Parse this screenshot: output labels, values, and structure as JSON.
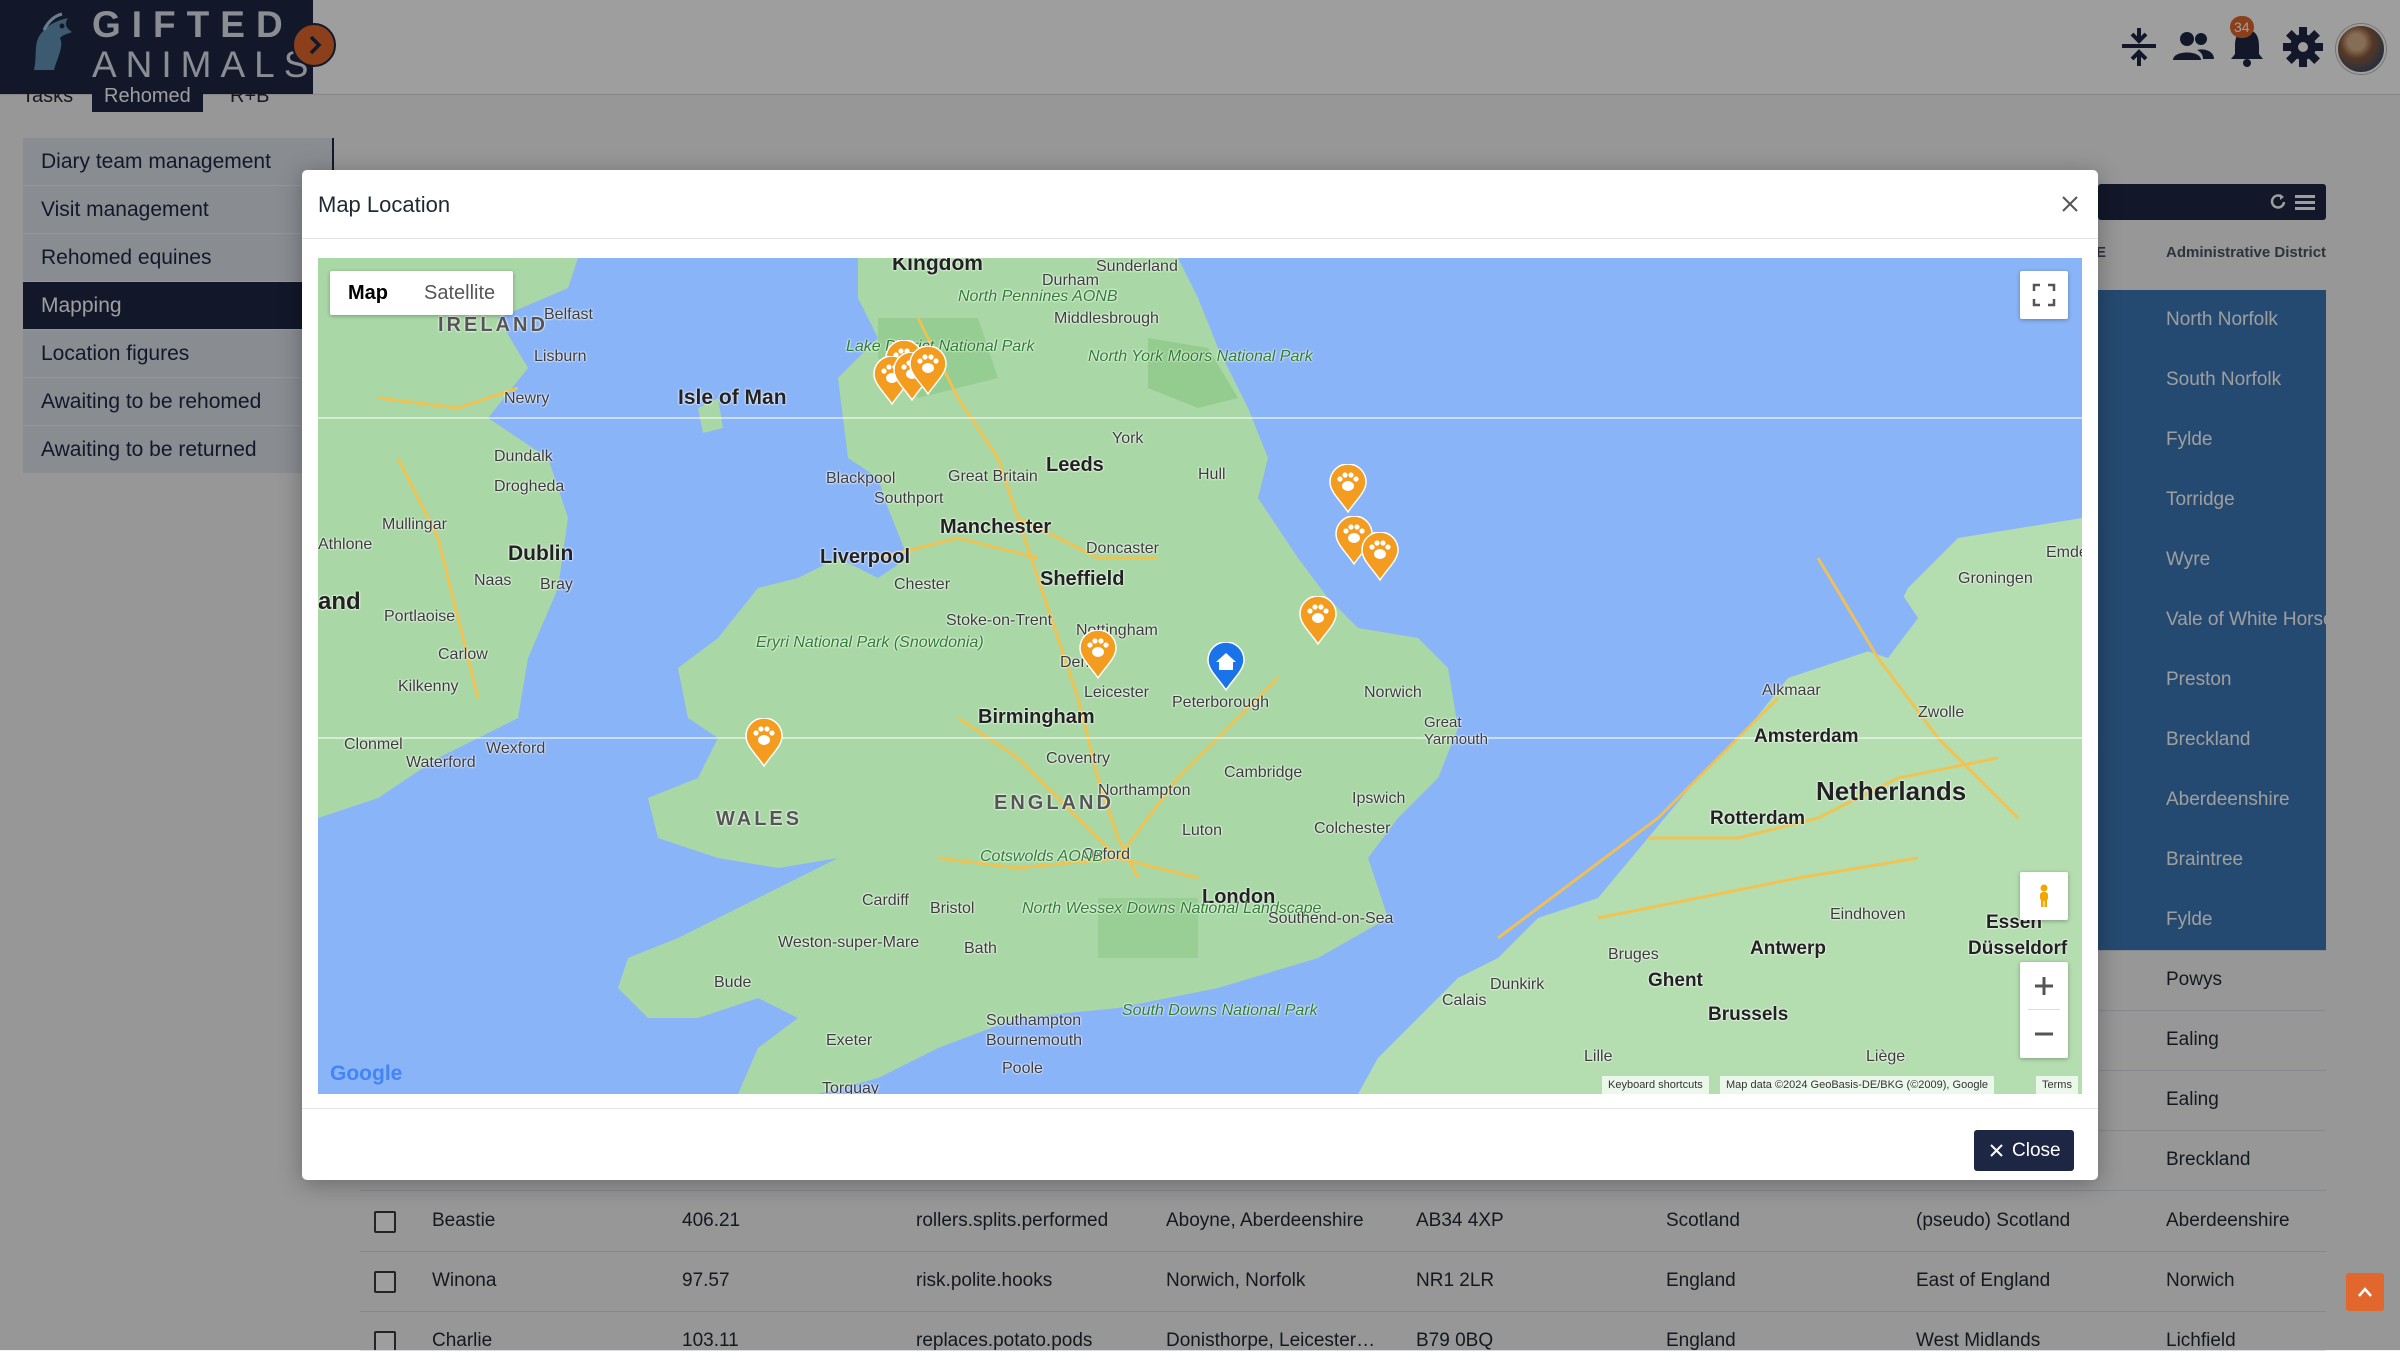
{
  "brand": {
    "line1": "GIFTED",
    "line2": "ANIMALS"
  },
  "header": {
    "notification_count": "34"
  },
  "tabs": [
    {
      "label": "Tasks"
    },
    {
      "label": "Rehomed"
    },
    {
      "label": "R+B"
    }
  ],
  "sidebar": {
    "items": [
      {
        "label": "Diary team management"
      },
      {
        "label": "Visit management"
      },
      {
        "label": "Rehomed equines"
      },
      {
        "label": "Mapping"
      },
      {
        "label": "Location figures"
      },
      {
        "label": "Awaiting to be rehomed"
      },
      {
        "label": "Awaiting to be returned"
      }
    ],
    "active_index": 3
  },
  "table": {
    "headers": {
      "col_e": "E",
      "admin_district": "Administrative District"
    },
    "partial_rows": [
      {
        "district": "North Norfolk",
        "selected": true
      },
      {
        "district": "South Norfolk",
        "selected": true
      },
      {
        "district": "Fylde",
        "selected": true
      },
      {
        "district": "Torridge",
        "selected": true
      },
      {
        "district": "Wyre",
        "selected": true
      },
      {
        "district": "Vale of White Horse",
        "selected": true
      },
      {
        "district": "Preston",
        "selected": true
      },
      {
        "district": "Breckland",
        "selected": true
      },
      {
        "district": "Aberdeenshire",
        "selected": true
      },
      {
        "district": "Braintree",
        "selected": true
      },
      {
        "district": "Fylde",
        "selected": true
      },
      {
        "district": "Powys",
        "selected": false
      },
      {
        "district": "Ealing",
        "selected": false
      },
      {
        "district": "Ealing",
        "selected": false
      },
      {
        "district": "Breckland",
        "selected": false
      }
    ],
    "rows": [
      {
        "name": "Beastie",
        "value": "406.21",
        "words": "rollers.splits.performed",
        "location": "Aboyne, Aberdeenshire",
        "postcode": "AB34 4XP",
        "country": "Scotland",
        "region": "(pseudo) Scotland",
        "district": "Aberdeenshire"
      },
      {
        "name": "Winona",
        "value": "97.57",
        "words": "risk.polite.hooks",
        "location": "Norwich, Norfolk",
        "postcode": "NR1 2LR",
        "country": "England",
        "region": "East of England",
        "district": "Norwich"
      },
      {
        "name": "Charlie",
        "value": "103.11",
        "words": "replaces.potato.pods",
        "location": "Donisthorpe, Leicester…",
        "postcode": "B79 0BQ",
        "country": "England",
        "region": "West Midlands",
        "district": "Lichfield"
      }
    ]
  },
  "modal": {
    "title": "Map Location",
    "close_label": "Close",
    "map": {
      "type_map": "Map",
      "type_satellite": "Satellite",
      "google": "Google",
      "keyboard_shortcuts": "Keyboard shortcuts",
      "map_data": "Map data ©2024 GeoBasis-DE/BKG (©2009), Google",
      "terms": "Terms",
      "labels": {
        "kingdom": "Kingdom",
        "sunderland": "Sunderland",
        "durham": "Durham",
        "north_pennines": "North Pennines AONB",
        "middlesbrough": "Middlesbrough",
        "lake_district": "Lake District National Park",
        "north_york_moors": "North York Moors National Park",
        "ireland": "IRELAND",
        "belfast": "Belfast",
        "lisburn": "Lisburn",
        "newry": "Newry",
        "isle_of_man": "Isle of Man",
        "dundalk": "Dundalk",
        "drogheda": "Drogheda",
        "mullingar": "Mullingar",
        "athlone": "Athlone",
        "dublin": "Dublin",
        "naas": "Naas",
        "bray": "Bray",
        "and": "and",
        "portlaoise": "Portlaoise",
        "carlow": "Carlow",
        "kilkenny": "Kilkenny",
        "clonmel": "Clonmel",
        "waterford": "Waterford",
        "wexford": "Wexford",
        "york": "York",
        "leeds": "Leeds",
        "hull": "Hull",
        "blackpool": "Blackpool",
        "great_britain": "Great Britain",
        "southport": "Southport",
        "manchester": "Manchester",
        "doncaster": "Doncaster",
        "liverpool": "Liverpool",
        "sheffield": "Sheffield",
        "chester": "Chester",
        "stoke": "Stoke-on-Trent",
        "nottingham": "Nottingham",
        "eryri": "Eryri National Park (Snowdonia)",
        "derby": "Derby",
        "norwich": "Norwich",
        "great_yarmouth": "Great Yarmouth",
        "leicester": "Leicester",
        "birmingham": "Birmingham",
        "peterborough": "Peterborough",
        "coventry": "Coventry",
        "cambridge": "Cambridge",
        "ipswich": "Ipswich",
        "northampton": "Northampton",
        "england": "ENGLAND",
        "wales": "WALES",
        "luton": "Luton",
        "colchester": "Colchester",
        "oxford": "Oxford",
        "cotswolds": "Cotswolds AONB",
        "cardiff": "Cardiff",
        "bristol": "Bristol",
        "london": "London",
        "north_wessex": "North Wessex Downs National Landscape",
        "southend": "Southend-on-Sea",
        "weston": "Weston-super-Mare",
        "bath": "Bath",
        "bude": "Bude",
        "southampton": "Southampton",
        "bournemouth": "Bournemouth",
        "poole": "Poole",
        "south_downs": "South Downs National Park",
        "exeter": "Exeter",
        "torquay": "Torquay",
        "calais": "Calais",
        "dunkirk": "Dunkirk",
        "bruges": "Bruges",
        "ghent": "Ghent",
        "brussels": "Brussels",
        "lille": "Lille",
        "liege": "Liège",
        "antwerp": "Antwerp",
        "eindhoven": "Eindhoven",
        "rotterdam": "Rotterdam",
        "netherlands": "Netherlands",
        "amsterdam": "Amsterdam",
        "alkmaar": "Alkmaar",
        "zwolle": "Zwolle",
        "groningen": "Groningen",
        "emden": "Emde",
        "essen": "Essen",
        "dusseldorf": "Düsseldorf"
      }
    }
  },
  "colors": {
    "navy": "#1d2744",
    "accent_orange": "#e2672c",
    "selected_row": "#3d78b6",
    "pin_orange": "#f39c1f",
    "home_pin": "#1a73e8"
  },
  "icons": {
    "header": [
      "collapse-icon",
      "team-icon",
      "bell-icon",
      "settings-icon"
    ],
    "pins": [
      "paw-icon",
      "home-icon"
    ]
  }
}
